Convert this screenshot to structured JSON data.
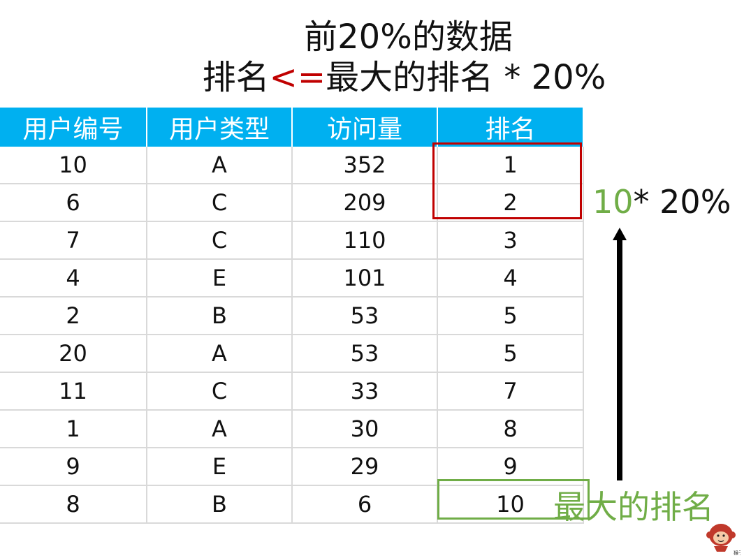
{
  "title": {
    "line1": "前20%的数据",
    "line2_prefix": "排名",
    "line2_operator": "<=",
    "line2_suffix": "最大的排名 * 20%"
  },
  "table": {
    "headers": [
      "用户编号",
      "用户类型",
      "访问量",
      "排名"
    ],
    "rows": [
      [
        "10",
        "A",
        "352",
        "1"
      ],
      [
        "6",
        "C",
        "209",
        "2"
      ],
      [
        "7",
        "C",
        "110",
        "3"
      ],
      [
        "4",
        "E",
        "101",
        "4"
      ],
      [
        "2",
        "B",
        "53",
        "5"
      ],
      [
        "20",
        "A",
        "53",
        "5"
      ],
      [
        "11",
        "C",
        "33",
        "7"
      ],
      [
        "1",
        "A",
        "30",
        "8"
      ],
      [
        "9",
        "E",
        "29",
        "9"
      ],
      [
        "8",
        "B",
        "6",
        "10"
      ]
    ]
  },
  "annotations": {
    "formula_value": "10",
    "formula_rest": "* 20%",
    "max_rank_label": "最大的排名"
  },
  "logo": {
    "icon": "monkey-logo-icon",
    "text": "猴子"
  },
  "colors": {
    "header_bg": "#00b0f0",
    "highlight_red": "#c00000",
    "highlight_green": "#70ad47"
  }
}
